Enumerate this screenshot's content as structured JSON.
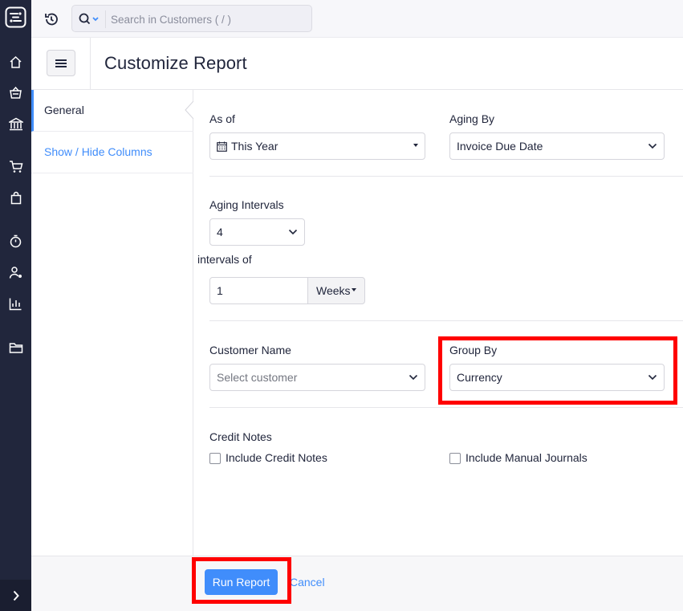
{
  "search": {
    "placeholder": "Search in Customers ( / )"
  },
  "header": {
    "title": "Customize Report"
  },
  "nav": {
    "items": [
      {
        "label": "General"
      },
      {
        "label": "Show / Hide Columns"
      }
    ]
  },
  "form": {
    "as_of": {
      "label": "As of",
      "value": "This Year"
    },
    "aging_by": {
      "label": "Aging By",
      "value": "Invoice Due Date"
    },
    "aging_intervals": {
      "label": "Aging Intervals",
      "value": "4"
    },
    "intervals_of": {
      "label": "intervals of",
      "value": "1",
      "unit": "Weeks"
    },
    "customer_name": {
      "label": "Customer Name",
      "placeholder": "Select customer"
    },
    "group_by": {
      "label": "Group By",
      "value": "Currency"
    },
    "credit_notes": {
      "label": "Credit Notes",
      "include_credit_notes": "Include Credit Notes",
      "include_manual_journals": "Include Manual Journals"
    }
  },
  "footer": {
    "run_label": "Run Report",
    "cancel_label": "Cancel"
  },
  "colors": {
    "sidebar": "#21263c",
    "accent": "#408dfb",
    "highlight": "#ff0000"
  }
}
